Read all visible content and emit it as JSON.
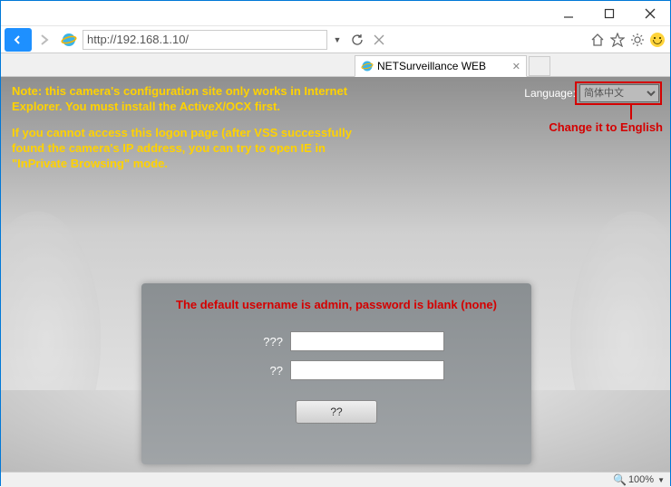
{
  "window": {
    "url": "http://192.168.1.10/",
    "tab_title": "NETSurveillance WEB"
  },
  "note": {
    "line1": "Note: this camera's configuration site only works in Internet Explorer. You must install the ActiveX/OCX first.",
    "line2": "If you cannot access this logon page (after VSS successfully found the camera's IP address, you can try to open IE in \"InPrivate Browsing\" mode."
  },
  "language": {
    "label": "Language:",
    "selected": "简体中文",
    "hint": "Change it to English"
  },
  "login": {
    "hint": "The default username is admin, password is blank (none)",
    "username_label": "???",
    "password_label": "??",
    "button": "??"
  },
  "status": {
    "zoom": "100%"
  }
}
